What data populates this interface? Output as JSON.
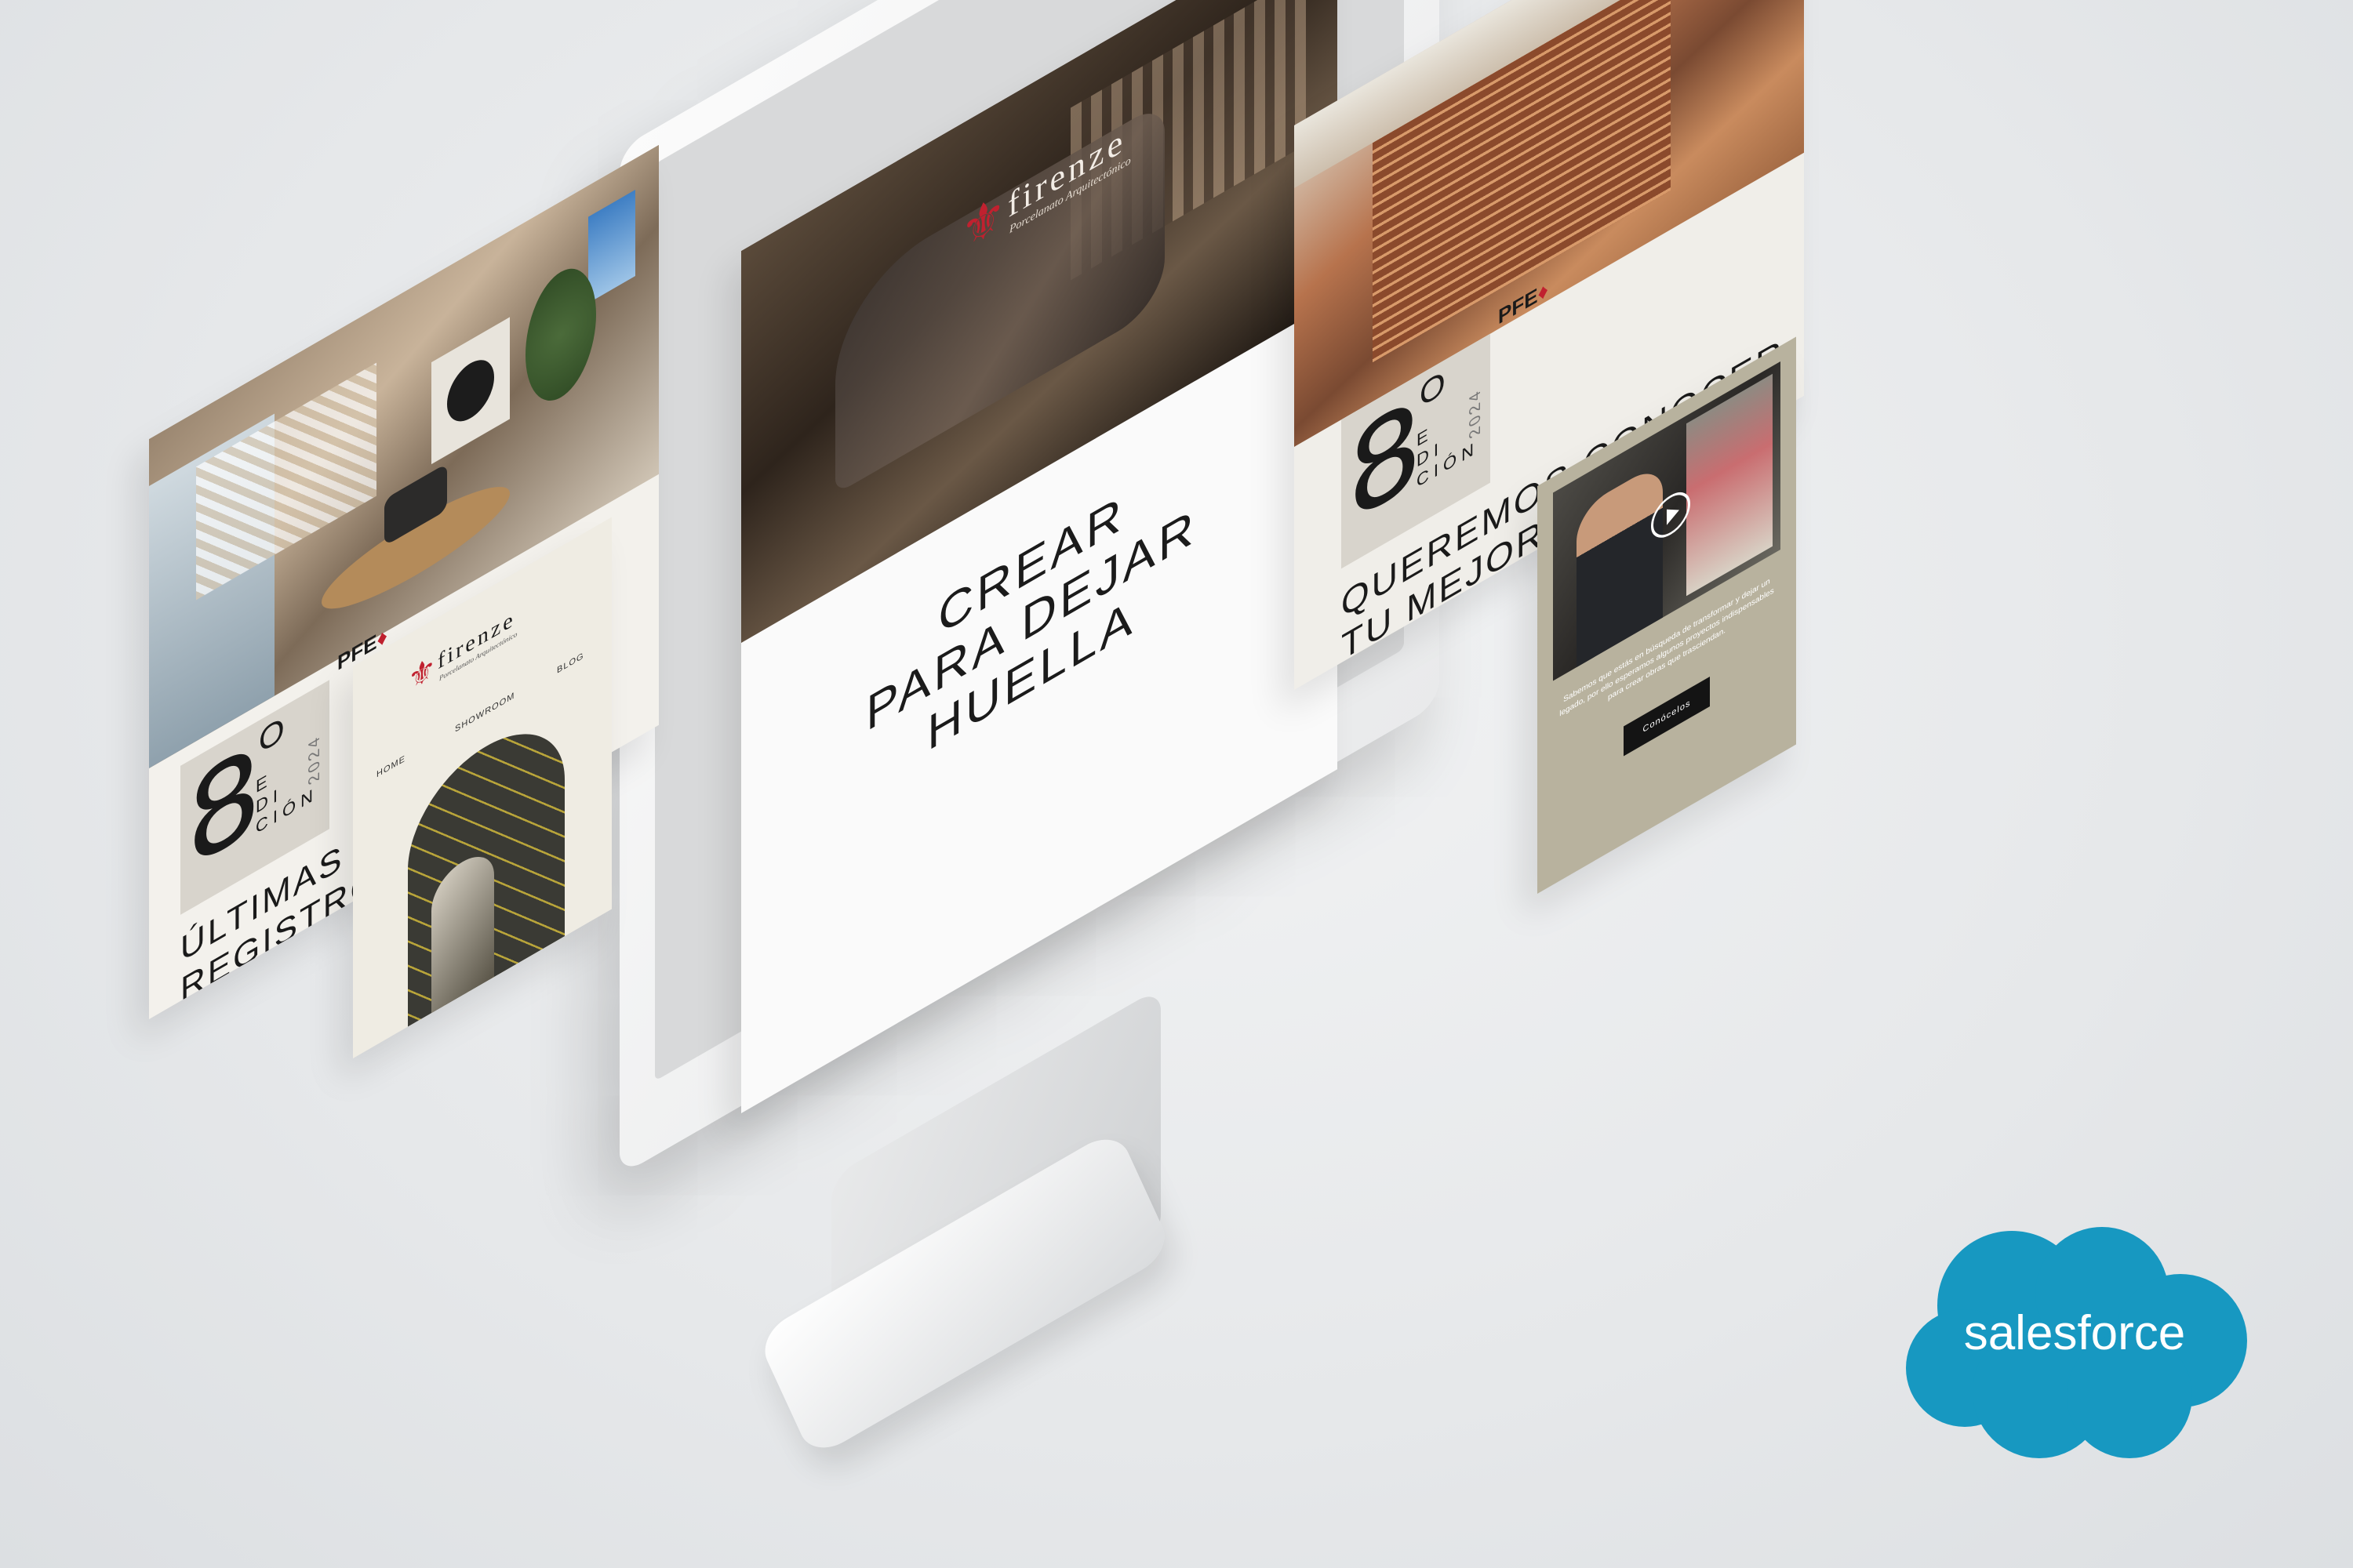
{
  "main_page": {
    "logo_text": "firenze",
    "logo_tagline": "Porcelanato Arquitectónico",
    "headline_lines": [
      "CREAR",
      "PARA DEJAR",
      "HUELLA"
    ]
  },
  "left_email": {
    "edition_number": "8",
    "edition_word": [
      "E",
      "DI",
      "CIÓN"
    ],
    "year": "2024",
    "pfe_label": "PFE",
    "headline_lines": [
      "ÚLTIMAS SEM",
      "REGISTRO PA"
    ]
  },
  "small_email": {
    "logo_text": "firenze",
    "logo_tagline": "Porcelanato Arquitectónico",
    "nav": [
      "HOME",
      "SHOWROOM",
      "BLOG"
    ]
  },
  "right_email": {
    "edition_number": "8",
    "edition_word": [
      "E",
      "DI",
      "CIÓN"
    ],
    "year": "2024",
    "pfe_label": "PFE",
    "headline_lines": [
      "QUEREMOS CONOCER",
      "TU MEJOR PR"
    ]
  },
  "video_card": {
    "body_text": "Sabemos que estás en búsqueda de transformar y dejar un legado, por ello esperamos algunos proyectos indispensables para crear obras que trasciendan.",
    "button_label": "Conócelos"
  },
  "brand": {
    "salesforce_label": "salesforce",
    "salesforce_color": "#1798c1",
    "firenze_red": "#c0212f"
  }
}
